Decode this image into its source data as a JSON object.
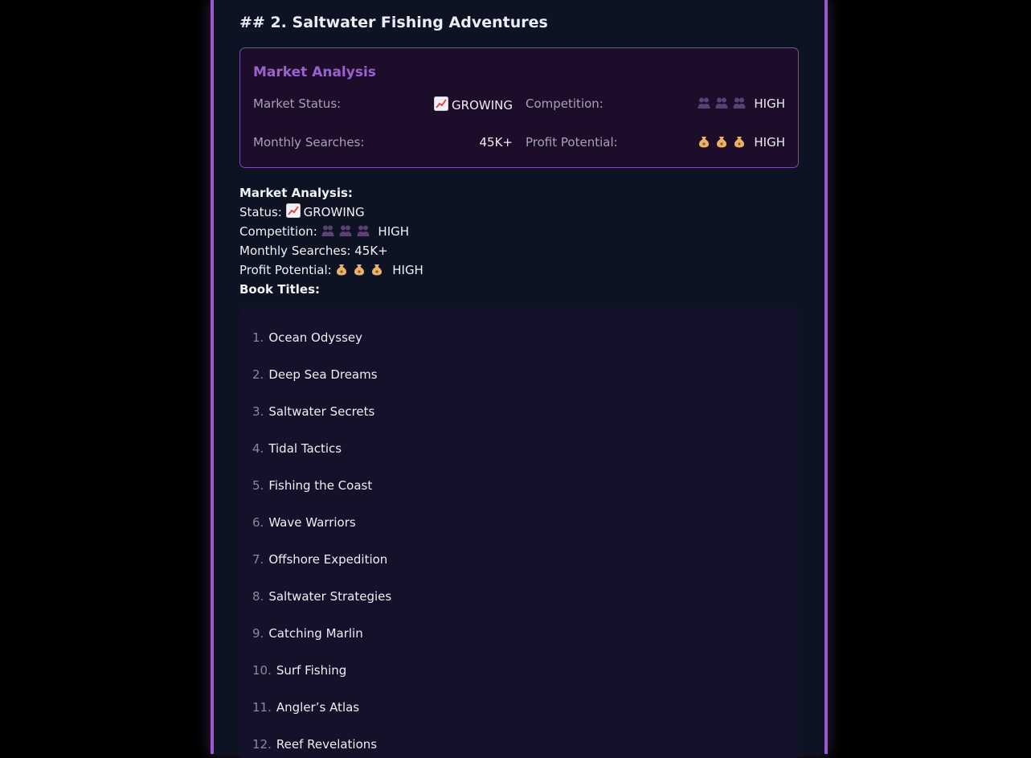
{
  "section": {
    "heading": "## 2. Saltwater Fishing Adventures"
  },
  "market_card": {
    "title": "Market Analysis",
    "market_status_label": "Market Status:",
    "market_status_value": "GROWING",
    "market_status_icon": "chart-increasing-icon",
    "competition_label": "Competition:",
    "competition_value": "HIGH",
    "competition_icon": "people-icon",
    "monthly_searches_label": "Monthly Searches:",
    "monthly_searches_value": "45K+",
    "profit_potential_label": "Profit Potential:",
    "profit_potential_value": "HIGH",
    "profit_icon": "money-bag-icon"
  },
  "summary": {
    "heading": "Market Analysis:",
    "status_label": "Status:",
    "status_value": "GROWING",
    "competition_label": "Competition:",
    "competition_value": "HIGH",
    "monthly_searches_label": "Monthly Searches:",
    "monthly_searches_value": "45K+",
    "profit_label": "Profit Potential:",
    "profit_value": "HIGH",
    "book_titles_heading": "Book Titles:"
  },
  "book_titles": [
    {
      "num": "1.",
      "title": "Ocean Odyssey"
    },
    {
      "num": "2.",
      "title": "Deep Sea Dreams"
    },
    {
      "num": "3.",
      "title": "Saltwater Secrets"
    },
    {
      "num": "4.",
      "title": "Tidal Tactics"
    },
    {
      "num": "5.",
      "title": "Fishing the Coast"
    },
    {
      "num": "6.",
      "title": "Wave Warriors"
    },
    {
      "num": "7.",
      "title": "Offshore Expedition"
    },
    {
      "num": "8.",
      "title": "Saltwater Strategies"
    },
    {
      "num": "9.",
      "title": "Catching Marlin"
    },
    {
      "num": "10.",
      "title": "Surf Fishing"
    },
    {
      "num": "11.",
      "title": "Angler’s Atlas"
    },
    {
      "num": "12.",
      "title": "Reef Revelations"
    }
  ],
  "colors": {
    "accent": "#9b59d0",
    "panel_bg": "#0e1324",
    "card_bg": "#1d0c2a",
    "card_title": "#9b62cf"
  }
}
